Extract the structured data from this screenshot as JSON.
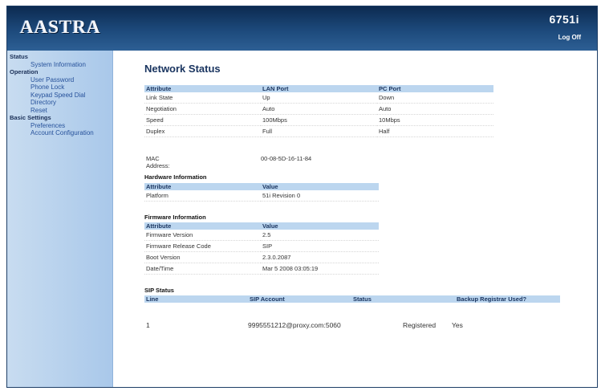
{
  "header": {
    "logo": "AASTRA",
    "model": "6751i",
    "logoff_label": "Log Off"
  },
  "sidebar": {
    "groups": [
      {
        "label": "Status",
        "items": [
          "System Information"
        ]
      },
      {
        "label": "Operation",
        "items": [
          "User Password",
          "Phone Lock",
          "Keypad Speed Dial",
          "Directory",
          "Reset"
        ]
      },
      {
        "label": "Basic Settings",
        "items": [
          "Preferences",
          "Account Configuration"
        ]
      }
    ]
  },
  "main": {
    "title": "Network Status",
    "network": {
      "headers": [
        "Attribute",
        "LAN Port",
        "PC Port"
      ],
      "rows": [
        [
          "Link State",
          "Up",
          "Down"
        ],
        [
          "Negotiation",
          "Auto",
          "Auto"
        ],
        [
          "Speed",
          "100Mbps",
          "10Mbps"
        ],
        [
          "Duplex",
          "Full",
          "Half"
        ]
      ]
    },
    "mac": {
      "label": "MAC Address:",
      "value": "00-08-5D-16-11-84"
    },
    "hardware": {
      "title": "Hardware Information",
      "headers": [
        "Attribute",
        "Value"
      ],
      "rows": [
        [
          "Platform",
          "51i Revision 0"
        ]
      ]
    },
    "firmware": {
      "title": "Firmware Information",
      "headers": [
        "Attribute",
        "Value"
      ],
      "rows": [
        [
          "Firmware Version",
          "2.5"
        ],
        [
          "Firmware Release Code",
          "SIP"
        ],
        [
          "Boot Version",
          "2.3.0.2087"
        ],
        [
          "Date/Time",
          "Mar 5 2008 03:05:19"
        ]
      ]
    },
    "sip": {
      "title": "SIP Status",
      "headers": [
        "Line",
        "SIP Account",
        "Status",
        "Backup Registrar Used?"
      ],
      "row": {
        "line": "1",
        "account": "9995551212@proxy.com:5060",
        "status": "Registered",
        "backup": "Yes"
      }
    }
  }
}
